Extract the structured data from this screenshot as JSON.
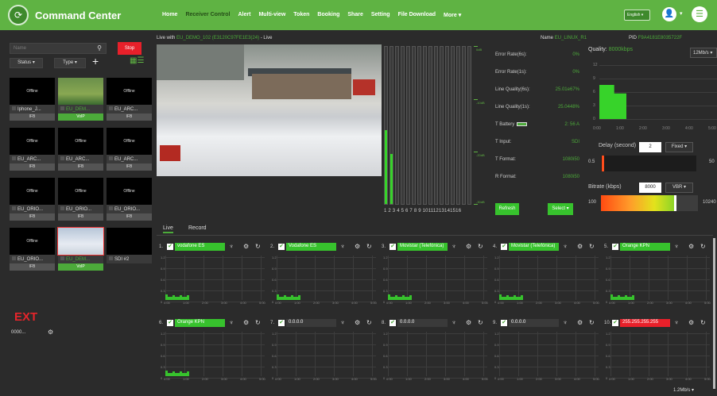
{
  "header": {
    "brand": "Command Center",
    "nav": [
      "Home",
      "Receiver Control",
      "Alert",
      "Multi-view",
      "Token",
      "Booking",
      "Share",
      "Setting",
      "File Download",
      "More ▾"
    ],
    "active_nav": 1,
    "language": "English ▾",
    "user_caret": "▾"
  },
  "left": {
    "search_placeholder": "Name",
    "stop_label": "Stop",
    "status_filter": "Status ▾",
    "type_filter": "Type ▾",
    "add_label": "+",
    "tiles": [
      {
        "thumb": "Offline",
        "name": "Iphone_J...",
        "tag": "IFB",
        "green": false,
        "sel": false
      },
      {
        "thumb": "",
        "name": "EU_DEM...",
        "tag": "VoIP",
        "green": true,
        "sel": false
      },
      {
        "thumb": "Offline",
        "name": "EU_ARC...",
        "tag": "IFB",
        "green": false,
        "sel": false
      },
      {
        "thumb": "Offline",
        "name": "EU_ARC...",
        "tag": "IFB",
        "green": false,
        "sel": false
      },
      {
        "thumb": "Offline",
        "name": "EU_ARC...",
        "tag": "IFB",
        "green": false,
        "sel": false
      },
      {
        "thumb": "Offline",
        "name": "EU_ARC...",
        "tag": "IFB",
        "green": false,
        "sel": false
      },
      {
        "thumb": "Offline",
        "name": "EU_ORIO...",
        "tag": "IFB",
        "green": false,
        "sel": false
      },
      {
        "thumb": "Offline",
        "name": "EU_ORIO...",
        "tag": "IFB",
        "green": false,
        "sel": false
      },
      {
        "thumb": "Offline",
        "name": "EU_ORIO...",
        "tag": "IFB",
        "green": false,
        "sel": false
      },
      {
        "thumb": "Offline",
        "name": "EU_ORIO...",
        "tag": "IFB",
        "green": false,
        "sel": false
      },
      {
        "thumb": "",
        "name": "EU_DEM...",
        "tag": "VoIP",
        "green": true,
        "sel": true
      },
      {
        "thumb": "",
        "name": "SDI #2",
        "tag": "",
        "green": false,
        "sel": false
      }
    ],
    "ext_label": "EXT",
    "mini_label": "0000..."
  },
  "live": {
    "title_prefix": "Live with",
    "source": "EU_DEMO_102 (E3120C97FE1E3(24)",
    "title_suffix": "- Live",
    "name_label": "Name",
    "name_value": "EU_LINUX_R1",
    "pid_label": "PID",
    "pid_value": "F9A4181E8035722F",
    "bar_numbers": "1 2 3 4 5 6 7 8 9 10111213141516",
    "bar_levels": [
      0.47,
      0.32,
      0,
      0,
      0,
      0,
      0,
      0,
      0,
      0,
      0,
      0,
      0,
      0,
      0,
      0
    ],
    "scale_labels": [
      "0dB",
      "-10dB",
      "-20dB",
      "-30dB"
    ]
  },
  "stats": {
    "rows": [
      {
        "label": "Error Rate(6s):",
        "value": "0%"
      },
      {
        "label": "Error Rate(1s):",
        "value": "0%"
      },
      {
        "label": "Line Quality(6s):",
        "value": "25.01e67%"
      },
      {
        "label": "Line Quality(1s):",
        "value": "25.0448%"
      },
      {
        "label": "T Battery",
        "value": "2: 56 A"
      },
      {
        "label": "T Input:",
        "value": "SDI"
      },
      {
        "label": "T Format:",
        "value": "1080i50"
      },
      {
        "label": "R Format:",
        "value": "1080i50"
      }
    ],
    "refresh_label": "Refresh",
    "select_label": "Select ▾"
  },
  "quality": {
    "label": "Quality:",
    "value": "8000kbps",
    "speed": "12Mb/s ▾",
    "yticks": [
      "12",
      "9",
      "6",
      "3",
      "0"
    ],
    "xticks": [
      "0:00",
      "1:00",
      "2:00",
      "3:00",
      "4:00",
      "5:00"
    ]
  },
  "delay": {
    "label": "Delay (second)",
    "value": "2",
    "mode": "Fixed ▾",
    "min": "0.5",
    "max": "50"
  },
  "bitrate": {
    "label": "Bitrate (kbps)",
    "value": "8000",
    "mode": "VBR ▾",
    "min": "100",
    "max": "10240"
  },
  "tabs": [
    "Live",
    "Record"
  ],
  "panels": [
    {
      "num": "1.",
      "name": "vodafone ES",
      "style": "green"
    },
    {
      "num": "2.",
      "name": "Vodafone ES",
      "style": "green"
    },
    {
      "num": "3.",
      "name": "Movistar (Telefónica)",
      "style": "green"
    },
    {
      "num": "4.",
      "name": "Movistar (Telefónica)",
      "style": "green"
    },
    {
      "num": "5.",
      "name": "Orange KPN",
      "style": "green"
    },
    {
      "num": "6.",
      "name": "Orange KPN",
      "style": "green"
    },
    {
      "num": "7.",
      "name": "0.0.0.0",
      "style": "dark"
    },
    {
      "num": "8.",
      "name": "0.0.0.0",
      "style": "dark"
    },
    {
      "num": "9.",
      "name": "0.0.0.0",
      "style": "dark"
    },
    {
      "num": "10.",
      "name": "255.255.255.255",
      "style": "red"
    }
  ],
  "panel_yticks": [
    "1.2",
    "0.9",
    "0.6",
    "0.3",
    "0"
  ],
  "panel_xticks": [
    "0:00",
    "1:00",
    "2:00",
    "3:00",
    "4:00",
    "5:00"
  ],
  "footer_speed": "1.2Mb/s ▾"
}
